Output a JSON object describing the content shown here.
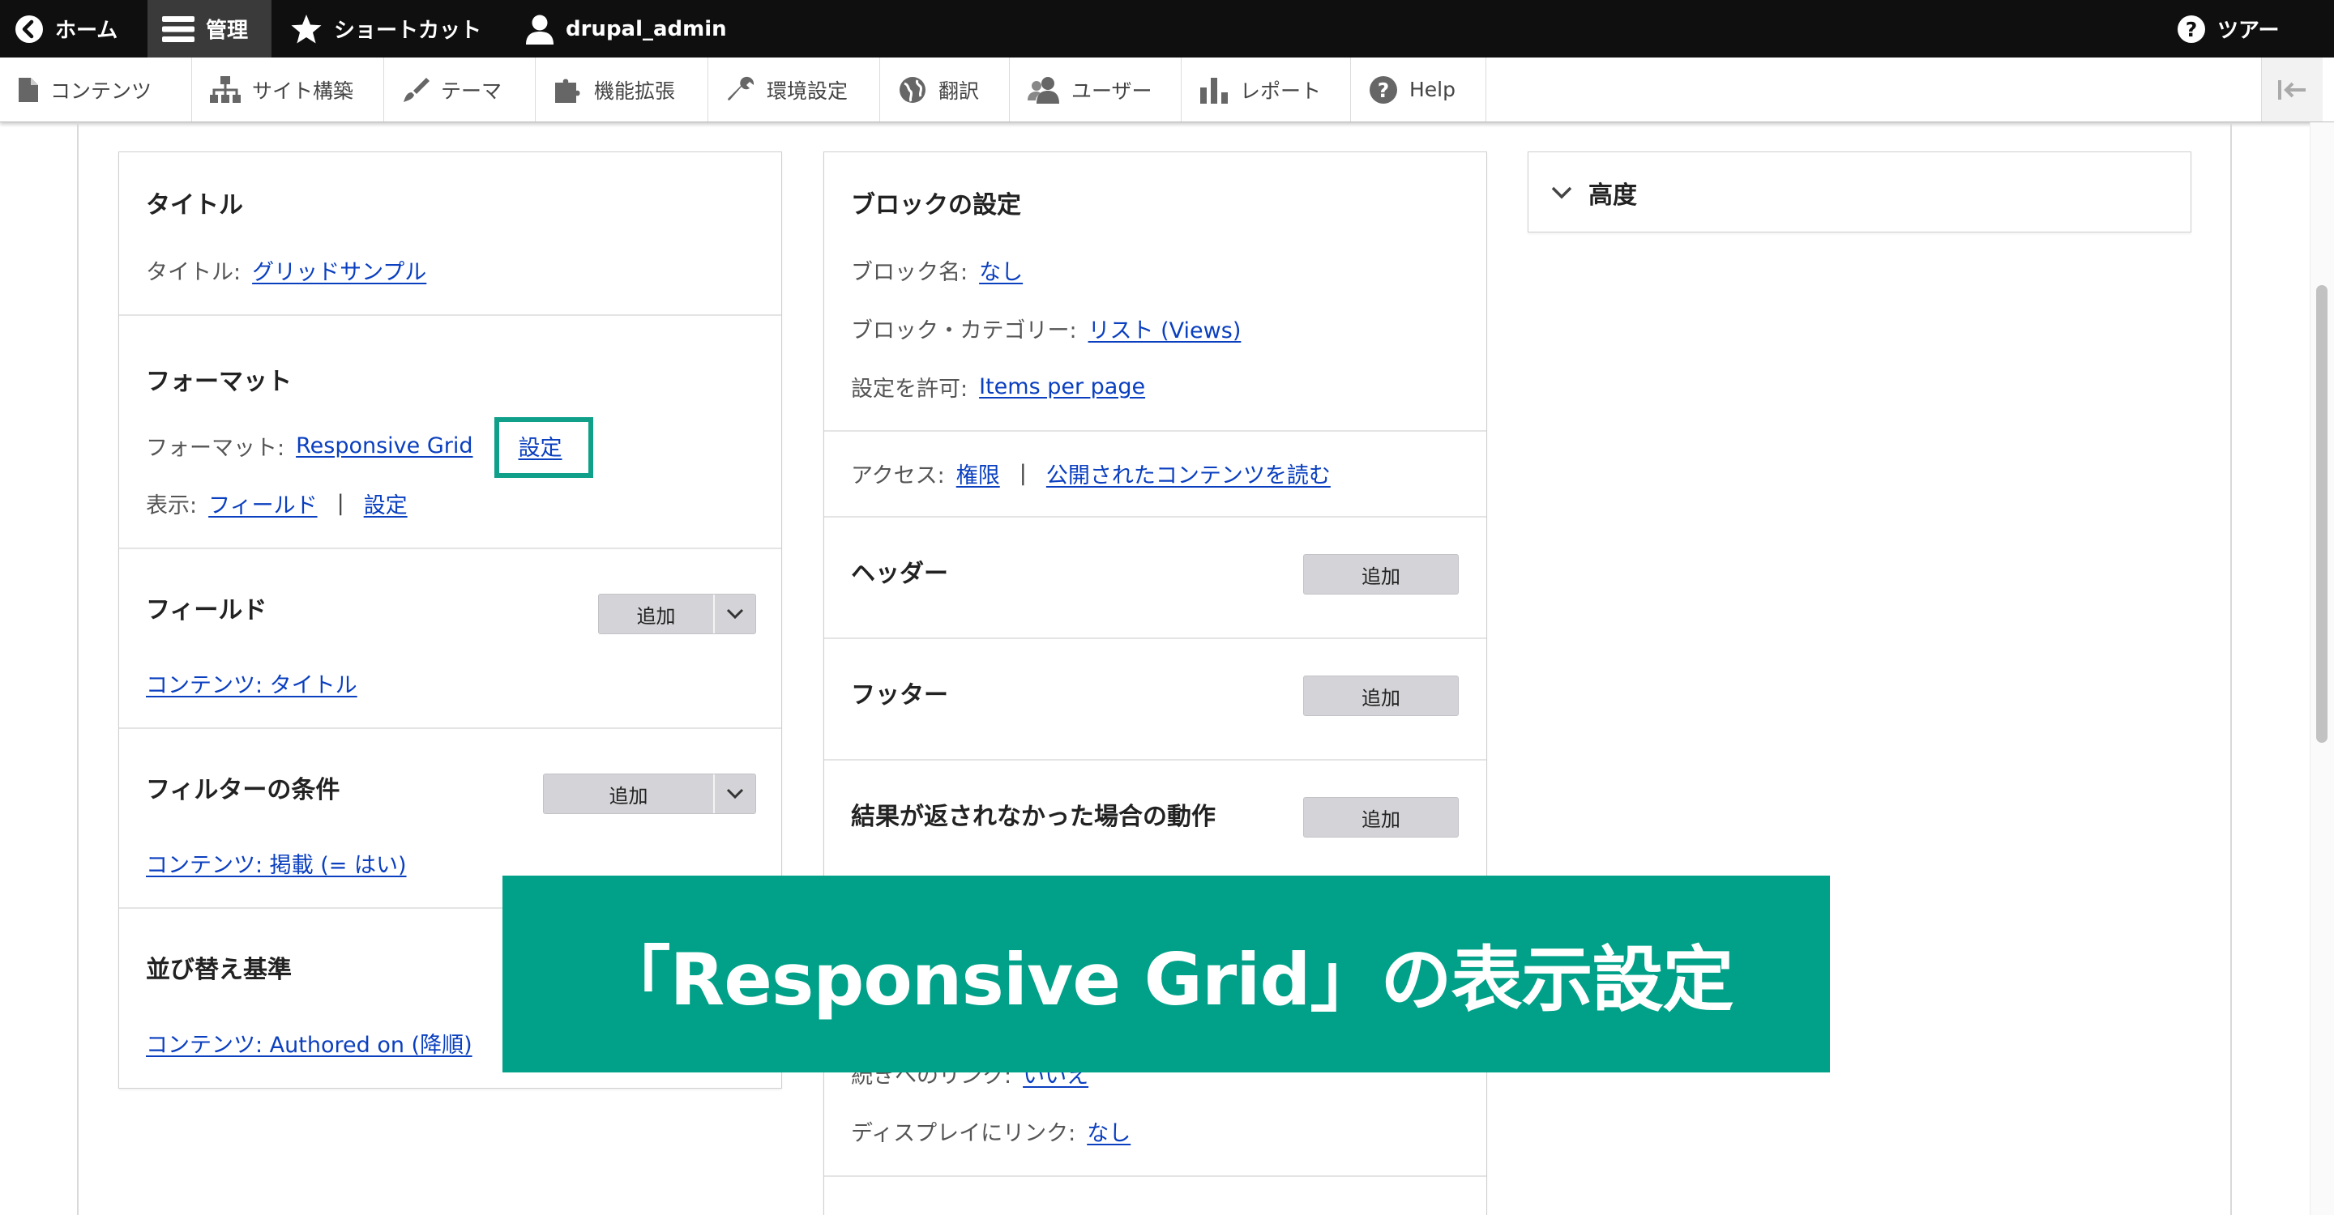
{
  "toolbar": {
    "home": "ホーム",
    "manage": "管理",
    "shortcuts": "ショートカット",
    "user": "drupal_admin",
    "tour": "ツアー"
  },
  "tray": {
    "items": [
      {
        "label": "コンテンツ",
        "icon": "file-icon"
      },
      {
        "label": "サイト構築",
        "icon": "sitemap-icon"
      },
      {
        "label": "テーマ",
        "icon": "paintbrush-icon"
      },
      {
        "label": "機能拡張",
        "icon": "puzzle-icon"
      },
      {
        "label": "環境設定",
        "icon": "wrench-icon"
      },
      {
        "label": "翻訳",
        "icon": "globe-icon"
      },
      {
        "label": "ユーザー",
        "icon": "people-icon"
      },
      {
        "label": "レポート",
        "icon": "bar-chart-icon"
      },
      {
        "label": "Help",
        "icon": "help-icon"
      }
    ]
  },
  "col1": {
    "title_section": {
      "heading": "タイトル",
      "key": "タイトル:",
      "value": "グリッドサンプル"
    },
    "format_section": {
      "heading": "フォーマット",
      "format_key": "フォーマット:",
      "format_value": "Responsive Grid",
      "format_settings": "設定",
      "show_key": "表示:",
      "show_value": "フィールド",
      "show_sep": "|",
      "show_settings": "設定"
    },
    "fields_section": {
      "heading": "フィールド",
      "add": "追加",
      "item": "コンテンツ: タイトル"
    },
    "filters_section": {
      "heading": "フィルターの条件",
      "add": "追加",
      "item": "コンテンツ: 掲載 (= はい)"
    },
    "sort_section": {
      "heading": "並び替え基準",
      "item": "コンテンツ: Authored on (降順)"
    }
  },
  "col2": {
    "block_section": {
      "heading": "ブロックの設定",
      "name_key": "ブロック名:",
      "name_value": "なし",
      "category_key": "ブロック・カテゴリー:",
      "category_value": "リスト (Views)",
      "allow_key": "設定を許可:",
      "allow_value": "Items per page"
    },
    "access_section": {
      "key": "アクセス:",
      "value1": "権限",
      "sep": "|",
      "value2": "公開されたコンテンツを読む"
    },
    "header_section": {
      "heading": "ヘッダー",
      "add": "追加"
    },
    "footer_section": {
      "heading": "フッター",
      "add": "追加"
    },
    "empty_section": {
      "heading": "結果が返されなかった場合の動作",
      "add": "追加"
    },
    "more_link": {
      "key": "続きへのリンク:",
      "value": "いいえ"
    },
    "display_link": {
      "key": "ディスプレイにリンク:",
      "value": "なし"
    }
  },
  "col3": {
    "advanced": "高度"
  },
  "banner": {
    "text": "「Responsive Grid」の表示設定"
  },
  "colors": {
    "banner": "#00a188",
    "highlight": "#10a08a",
    "link": "#0a3fbf",
    "toolbar": "#0f0f0f"
  }
}
